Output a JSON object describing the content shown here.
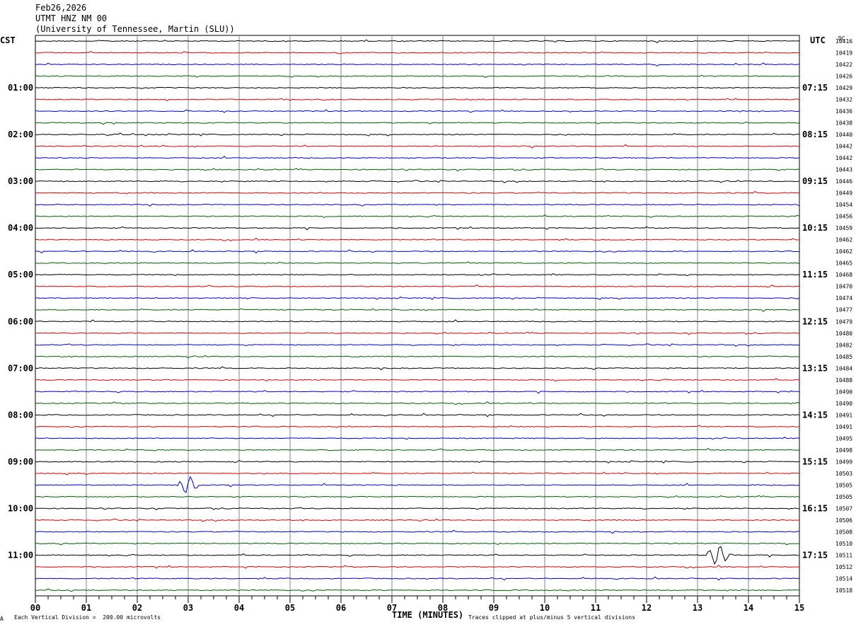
{
  "header": {
    "date": "Feb26,2026",
    "station": "UTMT HNZ NM 00",
    "network": "(University of Tennessee, Martin (SLU))"
  },
  "left_zone": "CST",
  "right_zone": "UTC",
  "dc_label": "DC",
  "footer": {
    "scale_marker": "A",
    "scale_note": "Each Vertical Division =  200.00 microvolts",
    "x_title": "TIME (MINUTES)",
    "clip_note": "Traces clipped at plus/minus 5 vertical divisions"
  },
  "colors": {
    "trace_cycle": [
      "#000000",
      "#e00000",
      "#0000d0",
      "#006000"
    ],
    "grid": "#8080a0"
  },
  "chart_data": {
    "type": "line",
    "xlabel": "TIME (MINUTES)",
    "x_ticks": [
      "00",
      "01",
      "02",
      "03",
      "04",
      "05",
      "06",
      "07",
      "08",
      "09",
      "10",
      "11",
      "12",
      "13",
      "14",
      "15"
    ],
    "xlim": [
      0,
      15
    ],
    "rows": 48,
    "row_minutes": 15,
    "left_ticks": [
      "01:00",
      "02:00",
      "03:00",
      "04:00",
      "05:00",
      "06:00",
      "07:00",
      "08:00",
      "09:00",
      "10:00",
      "11:00"
    ],
    "right_ticks": [
      "07:15",
      "08:15",
      "09:15",
      "10:15",
      "11:15",
      "12:15",
      "13:15",
      "14:15",
      "15:15",
      "16:15",
      "17:15"
    ],
    "hour_rows": [
      4,
      8,
      12,
      16,
      20,
      24,
      28,
      32,
      36,
      40,
      44
    ],
    "dc_offsets": [
      "10416",
      "10419",
      "10422",
      "10426",
      "10429",
      "10432",
      "10436",
      "10438",
      "10440",
      "10442",
      "10442",
      "10443",
      "10446",
      "10449",
      "10454",
      "10456",
      "10459",
      "10462",
      "10462",
      "10465",
      "10468",
      "10470",
      "10474",
      "10477",
      "10479",
      "10480",
      "10482",
      "10485",
      "10484",
      "10488",
      "10490",
      "10490",
      "10491",
      "10491",
      "10495",
      "10498",
      "10499",
      "10503",
      "10505",
      "10505",
      "10507",
      "10506",
      "10508",
      "10510",
      "10511",
      "10512",
      "10514",
      "10518"
    ],
    "events": [
      {
        "row": 38,
        "start_min": 2.8,
        "end_min": 3.3,
        "peak_min": 3.0,
        "amplitude_div": 0.9
      },
      {
        "row": 44,
        "start_min": 13.2,
        "end_min": 13.8,
        "peak_min": 13.4,
        "amplitude_div": 1.0
      }
    ]
  }
}
